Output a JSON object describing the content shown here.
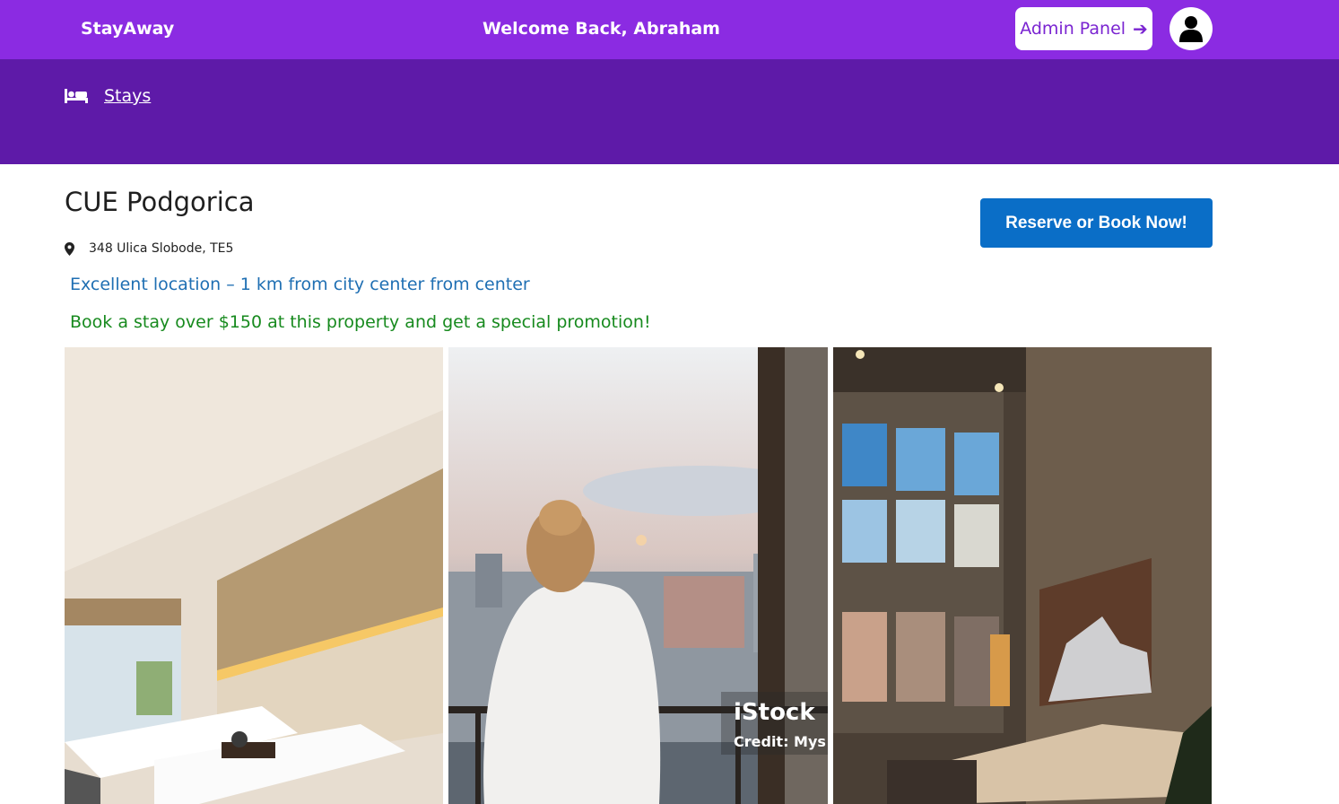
{
  "header": {
    "brand": "StayAway",
    "welcome": "Welcome Back, Abraham",
    "admin_label": "Admin Panel",
    "admin_icon": "arrow-right-icon",
    "avatar_icon": "user-icon"
  },
  "nav": {
    "items": [
      {
        "label": "Stays",
        "icon": "bed-icon"
      }
    ]
  },
  "property": {
    "name": "CUE Podgorica",
    "address": "348 Ulica Slobode, TE5",
    "address_icon": "map-pin-icon",
    "location_note": "Excellent location – 1 km from city center from center",
    "promotion": "Book a stay over $150 at this property and get a special promotion!",
    "reserve_label": "Reserve or Book Now!"
  },
  "photos": [
    {
      "subject": "hotel bedroom with twin beds"
    },
    {
      "subject": "woman in bathrobe on balcony overlooking city",
      "watermark": "iStock",
      "credit": "Credit: Mys"
    },
    {
      "subject": "high-ceiling living room with sectional sofa"
    }
  ],
  "colors": {
    "topbar": "#8b2be2",
    "subbar": "#5e1aa8",
    "reserve_button": "#0a6ec7",
    "location_text": "#1f6fb3",
    "promo_text": "#178a1e"
  }
}
